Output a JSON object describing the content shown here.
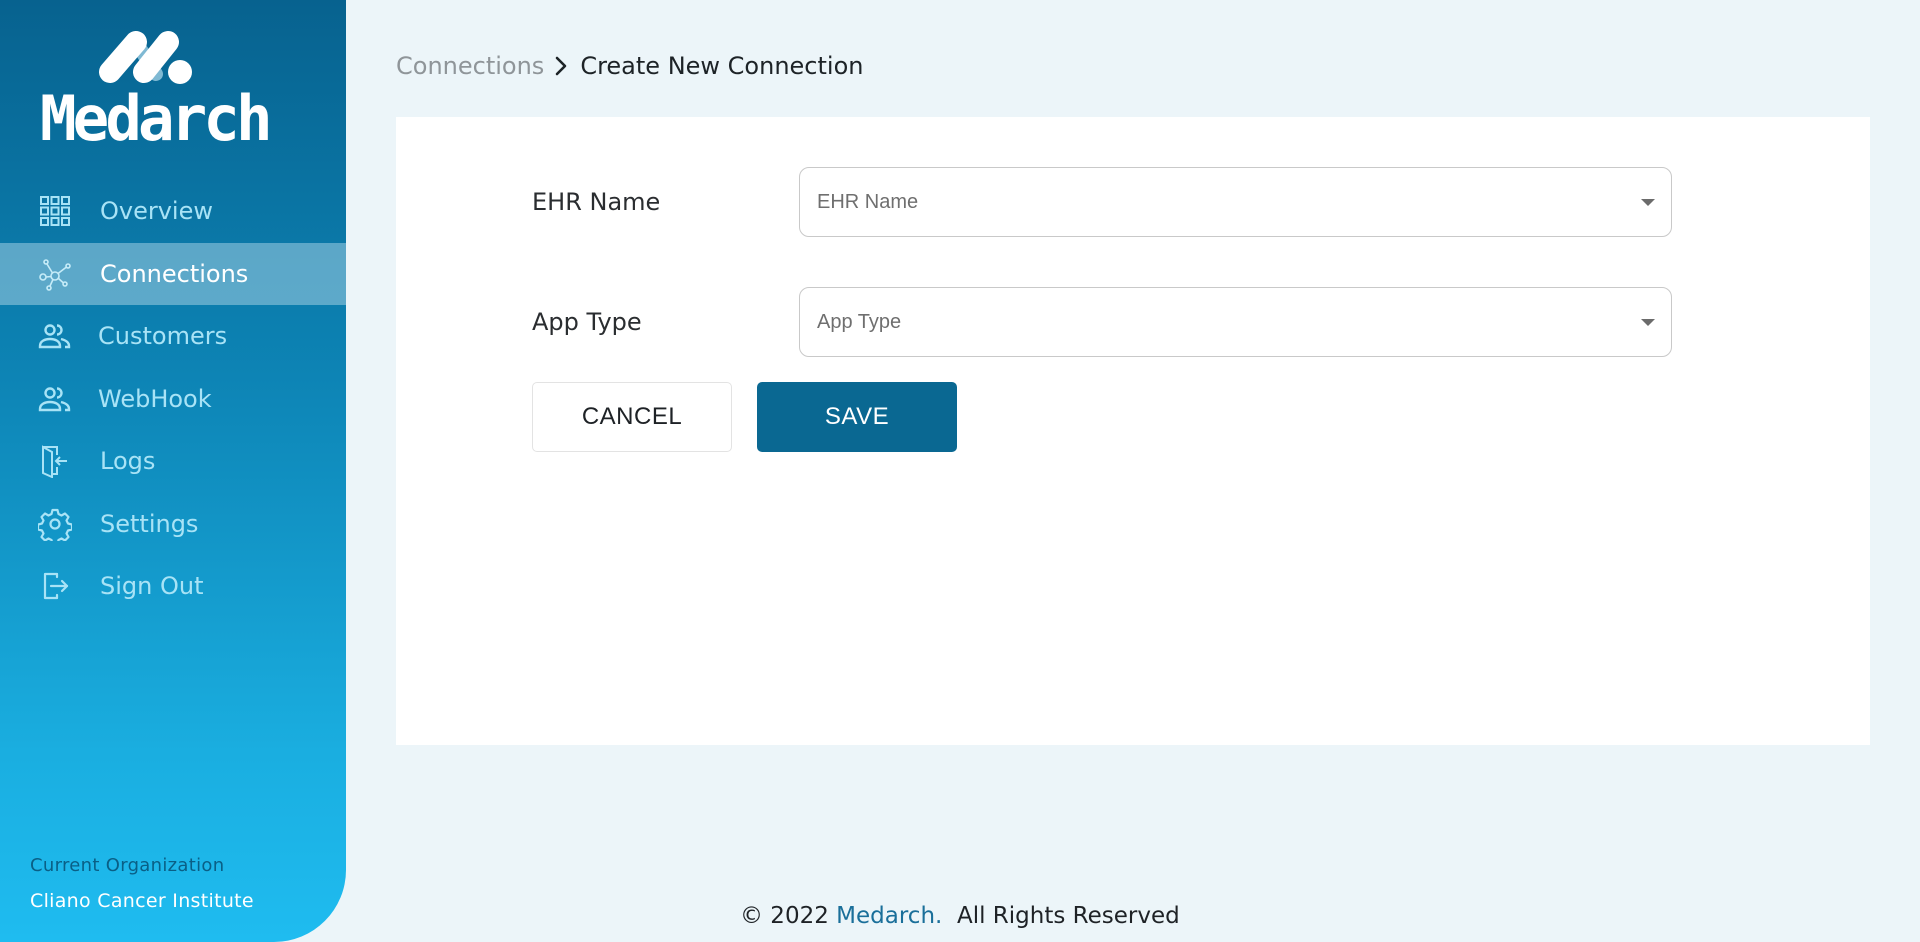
{
  "app": {
    "brand": "Medarch",
    "logo_icon": "molecule-m-logo"
  },
  "sidebar": {
    "items": [
      {
        "label": "Overview",
        "icon": "grid-icon",
        "active": false
      },
      {
        "label": "Connections",
        "icon": "network-icon",
        "active": true
      },
      {
        "label": "Customers",
        "icon": "users-icon",
        "active": false
      },
      {
        "label": "WebHook",
        "icon": "users-icon",
        "active": false
      },
      {
        "label": "Logs",
        "icon": "door-enter-icon",
        "active": false
      },
      {
        "label": "Settings",
        "icon": "gear-icon",
        "active": false
      },
      {
        "label": "Sign Out",
        "icon": "sign-out-icon",
        "active": false
      }
    ],
    "org_label": "Current Organization",
    "org_name": "Cliano Cancer Institute"
  },
  "breadcrumb": {
    "parent": "Connections",
    "separator_icon": "chevron-right-icon",
    "current": "Create New Connection"
  },
  "form": {
    "fields": [
      {
        "label": "EHR Name",
        "placeholder": "EHR Name",
        "value": ""
      },
      {
        "label": "App Type",
        "placeholder": "App Type",
        "value": ""
      }
    ],
    "cancel_label": "CANCEL",
    "save_label": "SAVE"
  },
  "footer": {
    "prefix": "© 2022 ",
    "brand": "Medarch.",
    "suffix": "  All Rights Reserved"
  },
  "colors": {
    "primary": "#0a6892",
    "sidebar_top": "#07628f",
    "sidebar_bottom": "#1fbcf0",
    "background": "#ecf5f9"
  }
}
